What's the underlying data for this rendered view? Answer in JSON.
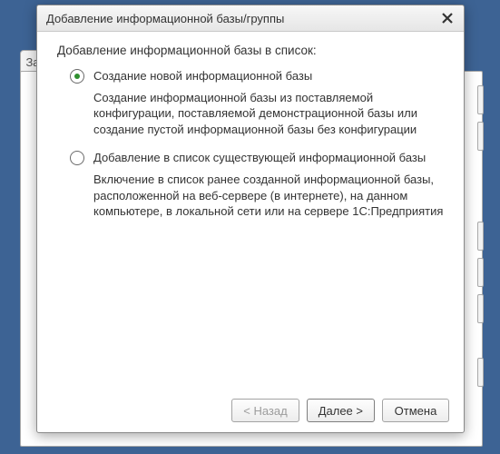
{
  "background": {
    "tab_label": "За"
  },
  "dialog": {
    "title": "Добавление информационной базы/группы",
    "heading": "Добавление информационной базы в список:",
    "options": [
      {
        "label": "Создание новой информационной базы",
        "description": "Создание информационной базы из поставляемой конфигурации, поставляемой демонстрационной базы или создание пустой информационной базы без конфигурации",
        "selected": true
      },
      {
        "label": "Добавление в список существующей информационной базы",
        "description": "Включение в список ранее созданной информационной базы, расположенной на веб-сервере (в интернете), на данном компьютере,  в локальной сети или на сервере 1С:Предприятия",
        "selected": false
      }
    ],
    "buttons": {
      "back": "< Назад",
      "next": "Далее >",
      "cancel": "Отмена"
    }
  }
}
